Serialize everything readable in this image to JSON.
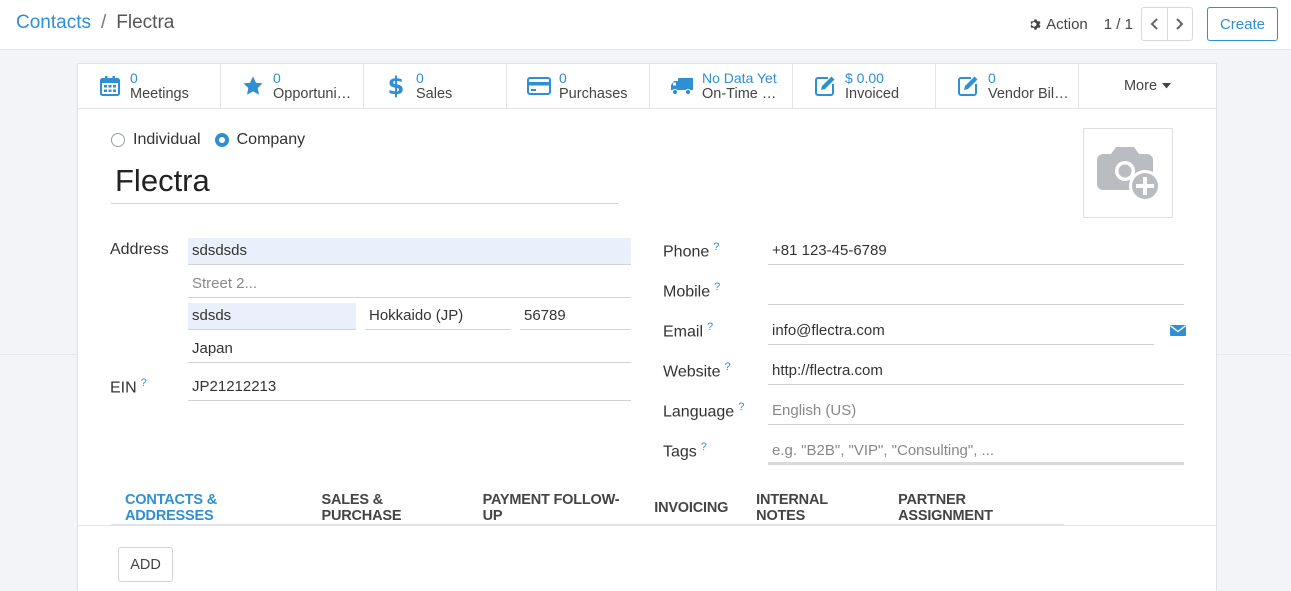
{
  "breadcrumb": {
    "parent": "Contacts",
    "separator": "/",
    "current": "Flectra"
  },
  "control": {
    "action_label": "Action",
    "pager": "1 / 1",
    "create_label": "Create"
  },
  "stat_buttons": [
    {
      "value": "0",
      "label": "Meetings",
      "icon": "calendar-icon"
    },
    {
      "value": "0",
      "label": "Opportuni…",
      "icon": "star-icon"
    },
    {
      "value": "0",
      "label": "Sales",
      "icon": "dollar-icon"
    },
    {
      "value": "0",
      "label": "Purchases",
      "icon": "credit-card-icon"
    },
    {
      "value": "No Data Yet",
      "label": "On-Time …",
      "icon": "truck-icon"
    },
    {
      "value": "$ 0.00",
      "label": "Invoiced",
      "icon": "edit-icon"
    },
    {
      "value": "0",
      "label": "Vendor Bil…",
      "icon": "edit-icon"
    }
  ],
  "more_label": "More",
  "company_type": {
    "individual": "Individual",
    "company": "Company",
    "selected": "company"
  },
  "name": "Flectra",
  "labels": {
    "address": "Address",
    "ein": "EIN",
    "phone": "Phone",
    "mobile": "Mobile",
    "email": "Email",
    "website": "Website",
    "language": "Language",
    "tags": "Tags",
    "help": "?"
  },
  "address": {
    "street": "sdsdsds",
    "street2_placeholder": "Street 2...",
    "city": "sdsds",
    "state": "Hokkaido (JP)",
    "zip": "56789",
    "country": "Japan"
  },
  "ein": "JP21212213",
  "phone": "+81 123-45-6789",
  "mobile": "",
  "email": "info@flectra.com",
  "website": "http://flectra.com",
  "language": "English (US)",
  "tags_placeholder": "e.g. \"B2B\", \"VIP\", \"Consulting\", ...",
  "tabs": [
    "CONTACTS & ADDRESSES",
    "SALES & PURCHASE",
    "PAYMENT FOLLOW-UP",
    "INVOICING",
    "INTERNAL NOTES",
    "PARTNER ASSIGNMENT"
  ],
  "add_label": "ADD",
  "colors": {
    "accent": "#2f8fd3",
    "required_bg": "#e9f0fb"
  }
}
